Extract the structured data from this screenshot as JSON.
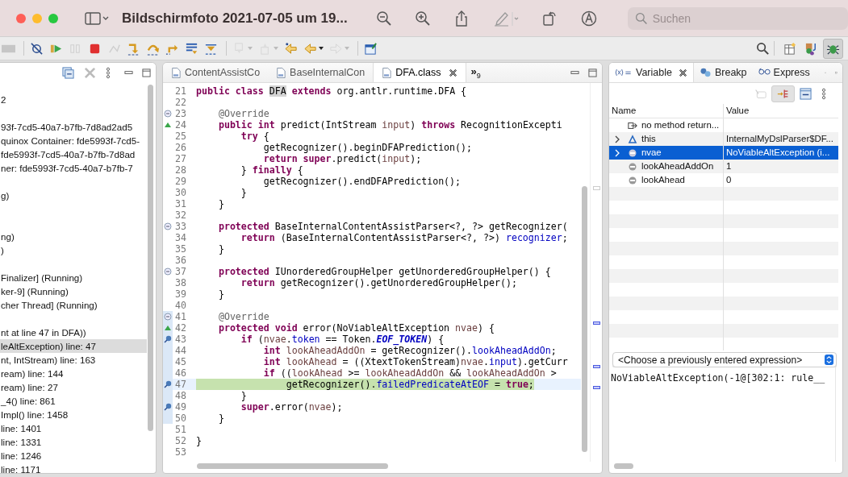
{
  "window": {
    "title": "Bildschirmfoto 2021-07-05 um 19...",
    "search": {
      "placeholder": "Suchen"
    }
  },
  "toolbar": {
    "buttons": [
      {
        "disabled": true
      },
      {
        "disabled": false
      },
      {
        "disabled": false
      },
      {
        "disabled": true
      },
      {
        "disabled": false
      },
      {
        "disabled": true
      },
      {
        "disabled": false
      },
      {
        "disabled": false
      },
      {
        "disabled": false
      },
      {
        "disabled": false
      },
      {
        "disabled": false
      },
      {
        "disabled": true
      },
      {
        "disabled": true
      },
      {
        "disabled": false
      },
      {
        "disabled": false
      },
      {
        "disabled": true
      },
      {
        "disabled": false
      }
    ],
    "perspectives": [
      {
        "selected": false
      },
      {
        "selected": false
      },
      {
        "selected": true
      }
    ]
  },
  "debug_view": {
    "rows": [
      {
        "text": "2",
        "selected": false
      },
      {
        "selected": false
      },
      {
        "text": "93f-7cd5-40a7-b7fb-7d8ad2ad5",
        "selected": false
      },
      {
        "text": "quinox Container: fde5993f-7cd5-",
        "selected": false
      },
      {
        "text": "fde5993f-7cd5-40a7-b7fb-7d8ad",
        "selected": false
      },
      {
        "text": "ner: fde5993f-7cd5-40a7-b7fb-7",
        "selected": false
      },
      {
        "selected": false
      },
      {
        "text": "g)",
        "selected": false
      },
      {
        "selected": false
      },
      {
        "selected": false
      },
      {
        "text": "ng)",
        "selected": false
      },
      {
        "text": ")",
        "selected": false
      },
      {
        "selected": false
      },
      {
        "text": "Finalizer] (Running)",
        "selected": false
      },
      {
        "text": "ker-9] (Running)",
        "selected": false
      },
      {
        "text": "cher Thread] (Running)",
        "selected": false
      },
      {
        "selected": false
      },
      {
        "text": "nt at line 47 in DFA))",
        "selected": false
      },
      {
        "text": "leAltException) line: 47",
        "selected": true
      },
      {
        "text": "nt, IntStream) line: 163",
        "selected": false
      },
      {
        "text": "ream) line: 144",
        "selected": false
      },
      {
        "text": "ream) line: 27",
        "selected": false
      },
      {
        "text": "_4() line: 861",
        "selected": false
      },
      {
        "text": "Impl() line: 1458",
        "selected": false
      },
      {
        "text": "line: 1401",
        "selected": false
      },
      {
        "text": "line: 1331",
        "selected": false
      },
      {
        "text": "line: 1246",
        "selected": false
      },
      {
        "text": "line: 1171",
        "selected": false
      }
    ]
  },
  "editor": {
    "tabs": [
      {
        "label": "ContentAssistCo",
        "selected": false
      },
      {
        "label": "BaseInternalCon",
        "selected": false
      },
      {
        "label": "DFA.class",
        "selected": true
      }
    ],
    "more_tabs": {
      "symbol": "»",
      "count": "9"
    },
    "lines": [
      {
        "number": "21",
        "tokens": [
          {
            "kind": "kw",
            "text": "public class "
          },
          {
            "kind": "occurrence",
            "text": "DFA"
          },
          {
            "kind": "kw",
            "text": " extends"
          },
          {
            "kind": "plain",
            "text": " org.antlr.runtime.DFA {"
          }
        ]
      },
      {
        "number": "22"
      },
      {
        "number": "23",
        "kind": "fold",
        "tokens": [
          {
            "kind": "ann",
            "text": "    @Override"
          }
        ]
      },
      {
        "number": "24",
        "kind": "override",
        "tokens": [
          {
            "kind": "kw",
            "text": "    public int"
          },
          {
            "kind": "plain",
            "text": " predict(IntStream "
          },
          {
            "kind": "local",
            "text": "input"
          },
          {
            "kind": "plain",
            "text": ") "
          },
          {
            "kind": "kw",
            "text": "throws"
          },
          {
            "kind": "plain",
            "text": " RecognitionExcepti"
          }
        ]
      },
      {
        "number": "25",
        "tokens": [
          {
            "kind": "kw",
            "text": "        try"
          },
          {
            "kind": "plain",
            "text": " {"
          }
        ]
      },
      {
        "number": "26",
        "tokens": [
          {
            "kind": "plain",
            "text": "            getRecognizer().beginDFAPrediction();"
          }
        ]
      },
      {
        "number": "27",
        "tokens": [
          {
            "kind": "kw",
            "text": "            return super"
          },
          {
            "kind": "plain",
            "text": ".predict("
          },
          {
            "kind": "local",
            "text": "input"
          },
          {
            "kind": "plain",
            "text": ");"
          }
        ]
      },
      {
        "number": "28",
        "tokens": [
          {
            "kind": "plain",
            "text": "        } "
          },
          {
            "kind": "kw",
            "text": "finally"
          },
          {
            "kind": "plain",
            "text": " {"
          }
        ]
      },
      {
        "number": "29",
        "tokens": [
          {
            "kind": "plain",
            "text": "            getRecognizer().endDFAPrediction();"
          }
        ]
      },
      {
        "number": "30",
        "tokens": [
          {
            "kind": "plain",
            "text": "        }"
          }
        ]
      },
      {
        "number": "31",
        "tokens": [
          {
            "kind": "plain",
            "text": "    }"
          }
        ]
      },
      {
        "number": "32"
      },
      {
        "number": "33",
        "kind": "fold",
        "tokens": [
          {
            "kind": "kw",
            "text": "    protected"
          },
          {
            "kind": "plain",
            "text": " BaseInternalContentAssistParser<?, ?> getRecognizer("
          }
        ]
      },
      {
        "number": "34",
        "tokens": [
          {
            "kind": "kw",
            "text": "        return"
          },
          {
            "kind": "plain",
            "text": " (BaseInternalContentAssistParser<?, ?>) "
          },
          {
            "kind": "field",
            "text": "recognizer"
          },
          {
            "kind": "plain",
            "text": ";"
          }
        ]
      },
      {
        "number": "35",
        "tokens": [
          {
            "kind": "plain",
            "text": "    }"
          }
        ]
      },
      {
        "number": "36"
      },
      {
        "number": "37",
        "kind": "fold",
        "tokens": [
          {
            "kind": "kw",
            "text": "    protected"
          },
          {
            "kind": "plain",
            "text": " IUnorderedGroupHelper getUnorderedGroupHelper() {"
          }
        ]
      },
      {
        "number": "38",
        "tokens": [
          {
            "kind": "kw",
            "text": "        return"
          },
          {
            "kind": "plain",
            "text": " getRecognizer().getUnorderedGroupHelper();"
          }
        ]
      },
      {
        "number": "39",
        "tokens": [
          {
            "kind": "plain",
            "text": "    }"
          }
        ]
      },
      {
        "number": "40"
      },
      {
        "number": "41",
        "kind": "fold",
        "in_range": true,
        "tokens": [
          {
            "kind": "ann",
            "text": "    @Override"
          }
        ]
      },
      {
        "number": "42",
        "kind": "override",
        "in_range": true,
        "tokens": [
          {
            "kind": "kw",
            "text": "    protected void"
          },
          {
            "kind": "plain",
            "text": " error(NoViableAltException "
          },
          {
            "kind": "local",
            "text": "nvae"
          },
          {
            "kind": "plain",
            "text": ") {"
          }
        ]
      },
      {
        "number": "43",
        "kind": "breakpoint",
        "in_range": true,
        "tokens": [
          {
            "kind": "kw",
            "text": "        if"
          },
          {
            "kind": "plain",
            "text": " ("
          },
          {
            "kind": "local",
            "text": "nvae"
          },
          {
            "kind": "plain",
            "text": "."
          },
          {
            "kind": "field",
            "text": "token"
          },
          {
            "kind": "plain",
            "text": " == Token."
          },
          {
            "kind": "static",
            "text": "EOF_TOKEN"
          },
          {
            "kind": "plain",
            "text": ") {"
          }
        ]
      },
      {
        "number": "44",
        "in_range": true,
        "tokens": [
          {
            "kind": "kw",
            "text": "            int"
          },
          {
            "kind": "local",
            "text": " lookAheadAddOn"
          },
          {
            "kind": "plain",
            "text": " = getRecognizer()."
          },
          {
            "kind": "field",
            "text": "lookAheadAddOn"
          },
          {
            "kind": "plain",
            "text": ";"
          }
        ]
      },
      {
        "number": "45",
        "in_range": true,
        "tokens": [
          {
            "kind": "kw",
            "text": "            int"
          },
          {
            "kind": "local",
            "text": " lookAhead"
          },
          {
            "kind": "plain",
            "text": " = ((XtextTokenStream)"
          },
          {
            "kind": "local",
            "text": "nvae"
          },
          {
            "kind": "plain",
            "text": "."
          },
          {
            "kind": "field",
            "text": "input"
          },
          {
            "kind": "plain",
            "text": ").getCurr"
          }
        ]
      },
      {
        "number": "46",
        "in_range": true,
        "tokens": [
          {
            "kind": "kw",
            "text": "            if"
          },
          {
            "kind": "plain",
            "text": " (("
          },
          {
            "kind": "local",
            "text": "lookAhead"
          },
          {
            "kind": "plain",
            "text": " >= "
          },
          {
            "kind": "local",
            "text": "lookAheadAddOn"
          },
          {
            "kind": "plain",
            "text": " && "
          },
          {
            "kind": "local",
            "text": "lookAheadAddOn"
          },
          {
            "kind": "plain",
            "text": " >"
          }
        ]
      },
      {
        "number": "47",
        "kind": "breakpoint",
        "in_range": true,
        "current": true,
        "tokens": [
          {
            "kind": "plain",
            "text": "                getRecognizer()."
          },
          {
            "kind": "field",
            "text": "failedPredicateAtEOF"
          },
          {
            "kind": "plain",
            "text": " = "
          },
          {
            "kind": "kw",
            "text": "true"
          },
          {
            "kind": "plain",
            "text": ";"
          }
        ]
      },
      {
        "number": "48",
        "in_range": true,
        "tokens": [
          {
            "kind": "plain",
            "text": "        }"
          }
        ]
      },
      {
        "number": "49",
        "kind": "breakpoint",
        "in_range": true,
        "tokens": [
          {
            "kind": "kw",
            "text": "        super"
          },
          {
            "kind": "plain",
            "text": ".error("
          },
          {
            "kind": "local",
            "text": "nvae"
          },
          {
            "kind": "plain",
            "text": ");"
          }
        ]
      },
      {
        "number": "50",
        "in_range": true,
        "tokens": [
          {
            "kind": "plain",
            "text": "    }"
          }
        ]
      },
      {
        "number": "51"
      },
      {
        "number": "52",
        "tokens": [
          {
            "kind": "plain",
            "text": "}"
          }
        ]
      },
      {
        "number": "53"
      }
    ]
  },
  "variables": {
    "tabs": [
      {
        "label": "Variable",
        "selected": true
      },
      {
        "label": "Breakp",
        "selected": false
      },
      {
        "label": "Express",
        "selected": false
      }
    ],
    "columns": [
      "Name",
      "Value"
    ],
    "rows": [
      {
        "kind": "return",
        "name": "no method return...",
        "selected": false
      },
      {
        "kind": "this",
        "name": "this",
        "value": "InternalMyDslParser$DF...",
        "expanded": false,
        "selected": false
      },
      {
        "kind": "local",
        "name": "nvae",
        "value": "NoViableAltException  (i...",
        "expanded": false,
        "selected": true
      },
      {
        "kind": "local",
        "name": "lookAheadAddOn",
        "value": "1",
        "selected": false
      },
      {
        "kind": "local",
        "name": "lookAhead",
        "value": "0",
        "selected": false
      }
    ],
    "expression": {
      "value": "<Choose a previously entered expression>"
    },
    "detail": "NoViableAltException(-1@[302:1: rule__"
  }
}
